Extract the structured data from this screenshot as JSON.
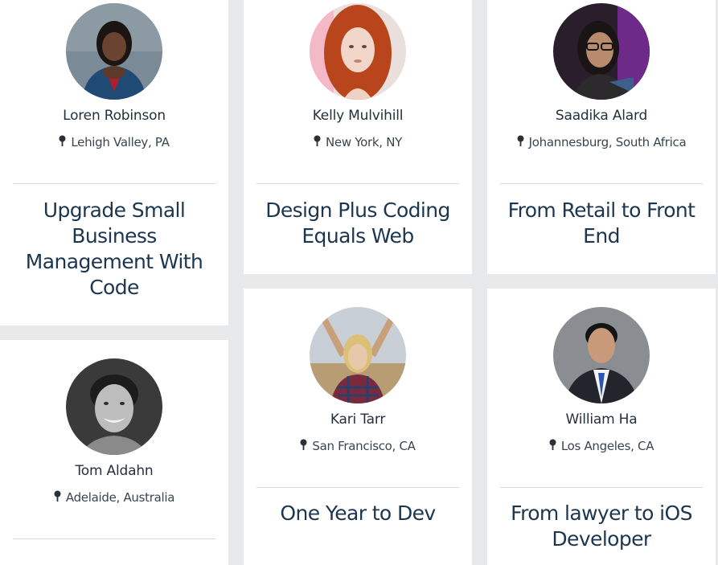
{
  "colors": {
    "page_background": "#e8e9ea",
    "card_background": "#ffffff",
    "title_text": "#1d3650",
    "name_text": "#24303d"
  },
  "location_icon": "map-pin-icon",
  "cards": [
    {
      "name": "Loren Robinson",
      "location": "Lehigh Valley, PA",
      "story_title": "Upgrade Small Business Management With Code",
      "photo": "portrait-woman-blazer"
    },
    {
      "name": "Kelly Mulvihill",
      "location": "New York, NY",
      "story_title": "Design Plus Coding Equals Web",
      "photo": "portrait-woman-red-hair"
    },
    {
      "name": "Saadika Alard",
      "location": "Johannesburg, South Africa",
      "story_title": "From Retail to Front End",
      "photo": "portrait-woman-glasses"
    },
    {
      "name": "Tom Aldahn",
      "location": "Adelaide, Australia",
      "story_title": "",
      "photo": "portrait-man-bw"
    },
    {
      "name": "Kari Tarr",
      "location": "San Francisco, CA",
      "story_title": "One Year to Dev",
      "photo": "portrait-woman-plaid"
    },
    {
      "name": "William Ha",
      "location": "Los Angeles, CA",
      "story_title": "From lawyer to iOS Developer",
      "photo": "portrait-man-suit"
    }
  ]
}
